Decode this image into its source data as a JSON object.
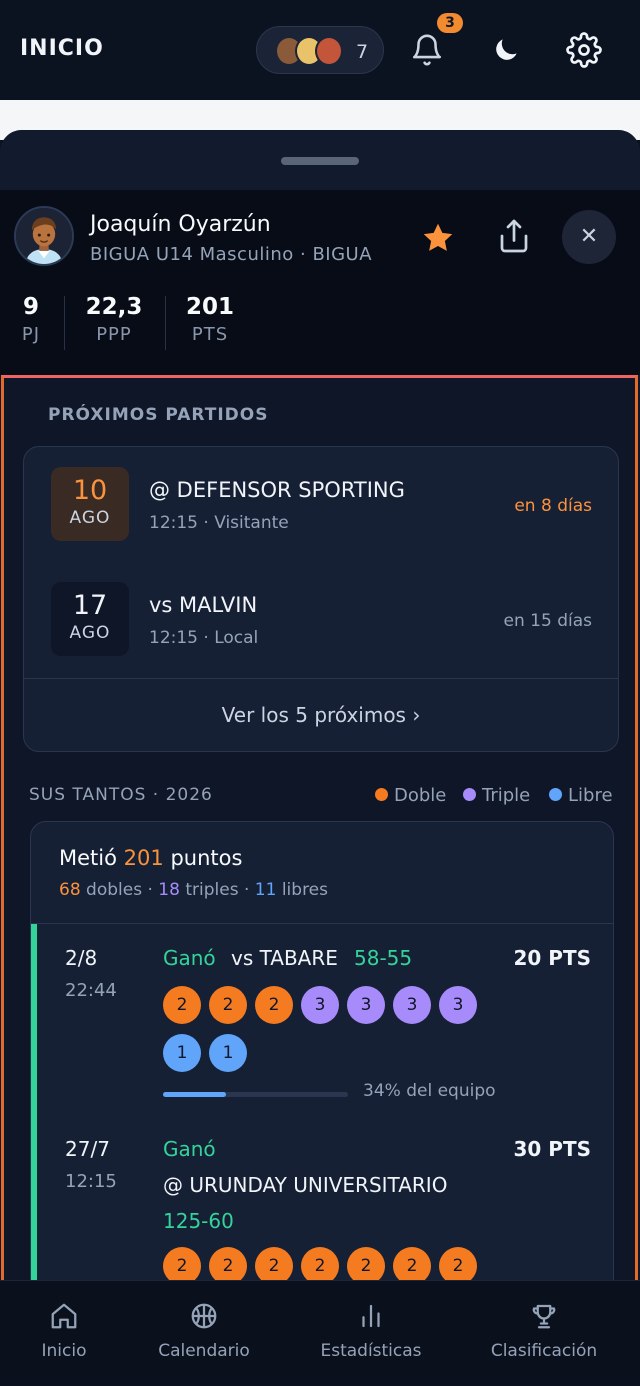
{
  "topbar": {
    "title": "INICIO",
    "followers_count": "7",
    "notifications_badge": "3"
  },
  "player": {
    "name": "Joaquín Oyarzún",
    "team": "BIGUA U14 Masculino · BIGUA",
    "stats": [
      {
        "value": "9",
        "label": "PJ"
      },
      {
        "value": "22,3",
        "label": "PPP"
      },
      {
        "value": "201",
        "label": "PTS"
      }
    ]
  },
  "upcoming": {
    "title": "PRÓXIMOS PARTIDOS",
    "matches": [
      {
        "day": "10",
        "month": "AGO",
        "opponent": "@ DEFENSOR SPORTING",
        "detail": "12:15 · Visitante",
        "when": "en 8 días"
      },
      {
        "day": "17",
        "month": "AGO",
        "opponent": "vs MALVIN",
        "detail": "12:15 · Local",
        "when": "en 15 días"
      }
    ],
    "see_more": "Ver los 5 próximos ›"
  },
  "points": {
    "title": "SUS TANTOS · 2026",
    "legend": [
      {
        "label": "Doble",
        "color": "#f47b20"
      },
      {
        "label": "Triple",
        "color": "#a78bfa"
      },
      {
        "label": "Libre",
        "color": "#60a5fa"
      }
    ],
    "summary_prefix": "Metió",
    "summary_total": "201",
    "summary_suffix": "puntos",
    "doubles": "68",
    "doubles_label": "dobles",
    "triples": "18",
    "triples_label": "triples",
    "free": "11",
    "free_label": "libres",
    "sep": "·",
    "games": [
      {
        "date": "2/8",
        "time": "22:44",
        "result": "Ganó",
        "opponent": "vs TABARE",
        "score": "58-55",
        "pts": "20 PTS",
        "shots": [
          "2",
          "2",
          "2",
          "3",
          "3",
          "3",
          "3",
          "1",
          "1"
        ],
        "team_share": 0.34,
        "share_label": "34% del equipo"
      },
      {
        "date": "27/7",
        "time": "12:15",
        "result": "Ganó",
        "opponent": "@ URUNDAY UNIVERSITARIO",
        "score": "125-60",
        "pts": "30 PTS",
        "shots": [
          "2",
          "2",
          "2",
          "2",
          "2",
          "2",
          "2"
        ]
      }
    ]
  },
  "nav": [
    {
      "label": "Inicio",
      "icon": "home-icon"
    },
    {
      "label": "Calendario",
      "icon": "basketball-icon"
    },
    {
      "label": "Estadísticas",
      "icon": "bar-chart-icon"
    },
    {
      "label": "Clasificación",
      "icon": "trophy-icon"
    }
  ]
}
